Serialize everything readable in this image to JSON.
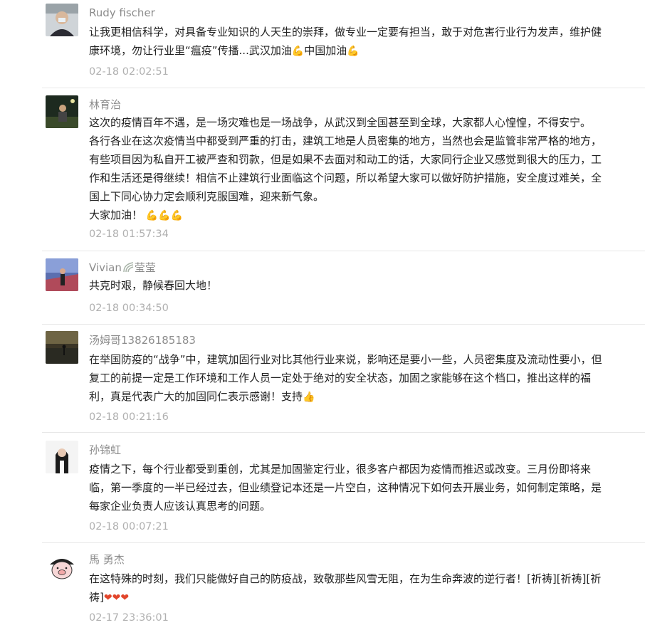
{
  "comments": [
    {
      "name": "Rudy fischer",
      "lines": [
        "让我更相信科学，对具备专业知识的人天生的崇拜，做专业一定要有担当，敢于对危害行业行为发声，维护健",
        "康环境，勿让行业里“瘟疫”传播...武汉加油",
        "中国加油"
      ],
      "time": "02-18 02:02:51"
    },
    {
      "name": "林育治",
      "lines": [
        "这次的疫情百年不遇，是一场灾难也是一场战争，从武汉到全国甚至到全球，大家都人心惶惶，不得安宁。",
        "各行各业在这次疫情当中都受到严重的打击，建筑工地是人员密集的地方，当然也会是监管非常严格的地方，",
        "有些项目因为私自开工被严查和罚款，但是如果不去面对和动工的话，大家同行企业又感觉到很大的压力，工",
        "作和生活还是得继续！相信不止建筑行业面临这个问题，所以希望大家可以做好防护措施，安全度过难关，全",
        "国上下同心协力定会顺利克服国难，迎来新气象。",
        "大家加油！"
      ],
      "time": "02-18 01:57:34"
    },
    {
      "name_parts": [
        "Vivian",
        "莹莹"
      ],
      "lines": [
        "共克时艰，静候春回大地！"
      ],
      "time": "02-18 00:34:50"
    },
    {
      "name": "汤姆哥13826185183",
      "lines": [
        "在举国防疫的“战争”中，建筑加固行业对比其他行业来说，影响还是要小一些，人员密集度及流动性要小，但",
        "复工的前提一定是工作环境和工作人员一定处于绝对的安全状态，加固之家能够在这个档口，推出这样的福",
        "利，真是代表广大的加固同仁表示感谢！支持"
      ],
      "time": "02-18 00:21:16"
    },
    {
      "name": "孙锦虹",
      "lines": [
        "疫情之下，每个行业都受到重创，尤其是加固鉴定行业，很多客户都因为疫情而推迟或改变。三月份即将来",
        "临，第一季度的一半已经过去，但业绩登记本还是一片空白，这种情况下如何去开展业务，如何制定策略，是",
        "每家企业负责人应该认真思考的问题。"
      ],
      "time": "02-18 00:07:21"
    },
    {
      "name": "馬 勇杰",
      "lines": [
        "在这特殊的时刻，我们只能做好自己的防疫战，致敬那些风雪无阻，在为生命奔波的逆行者！[祈祷][祈祷][祈",
        "祷]"
      ],
      "time": "02-17 23:36:01"
    }
  ],
  "icons": {
    "muscle": "💪",
    "thumbs_up": "👍",
    "heart": "❤"
  },
  "colors": {
    "name": "#8c8c8c",
    "text": "#222222",
    "time": "#b0b0b0",
    "divider": "#e8e8e8"
  }
}
